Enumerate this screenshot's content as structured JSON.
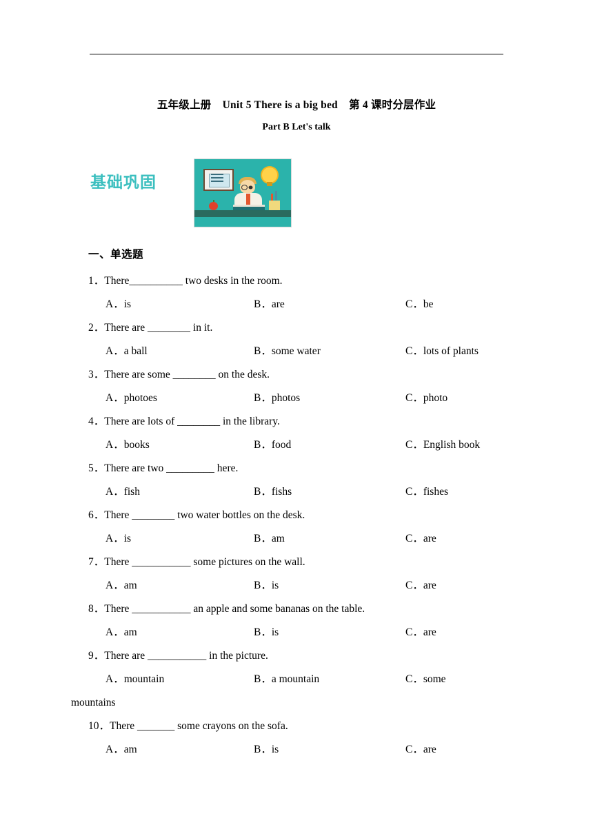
{
  "document": {
    "title_line1": "五年级上册    Unit 5 There is a big bed    第 4 课时分层作业",
    "title_line2": "Part B Let's talk",
    "section_label": "基础巩固",
    "banner_alt": "classroom-illustration"
  },
  "exercise": {
    "heading": "一、单选题",
    "questions": [
      {
        "stem": "1．There__________ two desks in the room.",
        "options": [
          "A．is",
          "B．are",
          "C．be"
        ]
      },
      {
        "stem": "2．There are ________ in it.",
        "options": [
          "A．a ball",
          "B．some water",
          "C．lots of plants"
        ]
      },
      {
        "stem": "3．There are some ________ on the desk.",
        "options": [
          "A．photoes",
          "B．photos",
          "C．photo"
        ]
      },
      {
        "stem": "4．There are lots of ________ in the library.",
        "options": [
          "A．books",
          "B．food",
          "C．English book"
        ]
      },
      {
        "stem": "5．There are two _________ here.",
        "options": [
          "A．fish",
          "B．fishs",
          "C．fishes"
        ]
      },
      {
        "stem": "6．There ________ two water bottles on the desk.",
        "options": [
          "A．is",
          "B．am",
          "C．are"
        ]
      },
      {
        "stem": "7．There ___________ some pictures on the wall.",
        "options": [
          "A．am",
          "B．is",
          "C．are"
        ]
      },
      {
        "stem": "8．There ___________ an apple and some bananas on the table.",
        "options": [
          "A．am",
          "B．is",
          "C．are"
        ]
      },
      {
        "stem": "9．There are ___________ in the picture.",
        "options": [
          "A．mountain",
          "B．a mountain",
          "C．some"
        ],
        "spill": "mountains"
      },
      {
        "stem": "10．There _______ some crayons on the sofa.",
        "options": [
          "A．am",
          "B．is",
          "C．are"
        ]
      }
    ]
  }
}
